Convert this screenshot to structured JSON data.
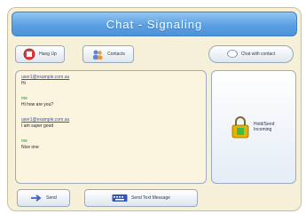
{
  "window": {
    "title": "Chat - Signaling"
  },
  "toolbar": {
    "left_button": "Hang Up",
    "right_button": "Contacts",
    "pill_button": "Chat with contact"
  },
  "chat": {
    "messages": [
      {
        "sender": "user1@example.com.au",
        "text": "Hi",
        "type": "a"
      },
      {
        "sender": "me",
        "text": "Hi how are you?",
        "type": "b"
      },
      {
        "sender": "user1@example.com.au",
        "text": "I am super good",
        "type": "a"
      },
      {
        "sender": "me",
        "text": "Nice one",
        "type": "b"
      }
    ]
  },
  "side": {
    "lock_label": "Hold/Send Incoming"
  },
  "bottom": {
    "left_button": "Send",
    "right_button": "Send Text Message"
  },
  "colors": {
    "accent": "#5b9fe2",
    "panel": "#f6f0d8",
    "lock": "#e6b200"
  }
}
